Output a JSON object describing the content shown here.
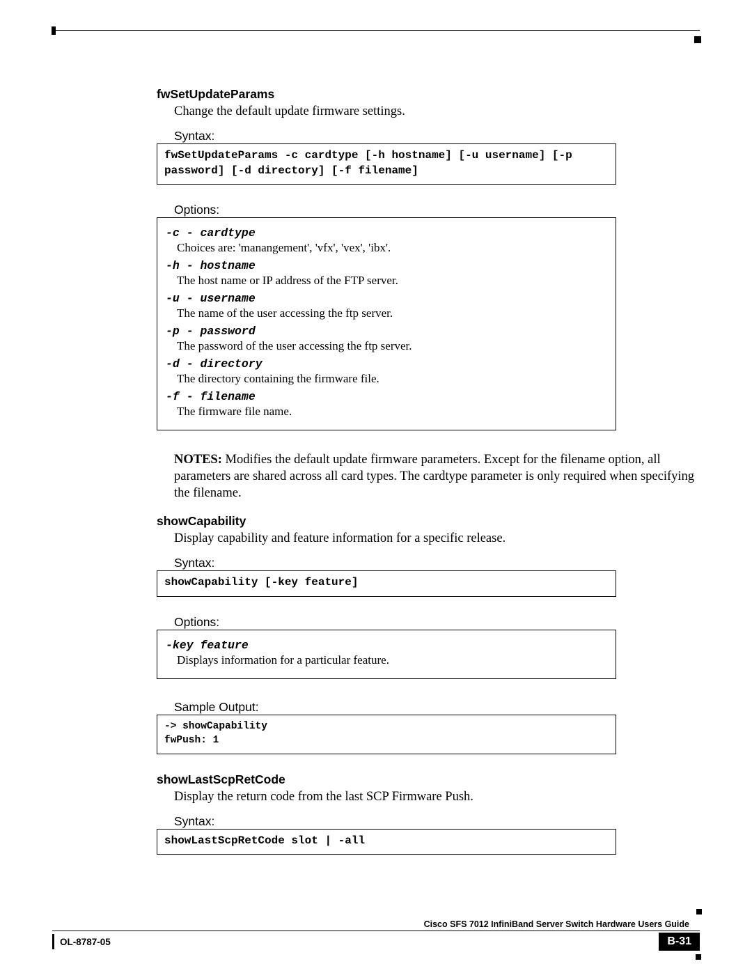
{
  "commands": {
    "fwSetUpdateParams": {
      "heading": "fwSetUpdateParams",
      "desc": "Change the default update firmware settings.",
      "syntax_label": "Syntax:",
      "syntax_box": "fwSetUpdateParams -c cardtype [-h hostname] [-u username] [-p password] [-d directory] [-f filename]",
      "options_label": "Options:",
      "options": [
        {
          "flag": "-c - cardtype",
          "desc": "Choices are: 'manangement', 'vfx', 'vex', 'ibx'."
        },
        {
          "flag": "-h - hostname",
          "desc": "The host name or IP address of the FTP server."
        },
        {
          "flag": "-u - username",
          "desc": "The name of the user accessing the ftp server."
        },
        {
          "flag": "-p - password",
          "desc": "The password of the user accessing the ftp server."
        },
        {
          "flag": "-d - directory",
          "desc": "The directory containing the firmware file."
        },
        {
          "flag": "-f - filename",
          "desc": "The firmware file name."
        }
      ],
      "notes_label": "NOTES:",
      "notes_body": " Modifies the default update firmware parameters.  Except for the filename option, all parameters are shared across all card types. The cardtype parameter is only required when specifying the filename."
    },
    "showCapability": {
      "heading": "showCapability",
      "desc": "Display capability and feature information for a specific release.",
      "syntax_label": "Syntax:",
      "syntax_box": "showCapability [-key feature]",
      "options_label": "Options:",
      "options": [
        {
          "flag": "-key feature",
          "desc": "Displays information for a particular feature."
        }
      ],
      "sample_label": "Sample Output:",
      "sample_box": "-> showCapability\nfwPush: 1"
    },
    "showLastScpRetCode": {
      "heading": "showLastScpRetCode",
      "desc": "Display the return code from the last SCP Firmware Push.",
      "syntax_label": "Syntax:",
      "syntax_box": "showLastScpRetCode slot | -all"
    }
  },
  "footer": {
    "doc_title": "Cisco SFS 7012 InfiniBand Server Switch Hardware Users Guide",
    "doc_code": "OL-8787-05",
    "page_num": "B-31"
  }
}
